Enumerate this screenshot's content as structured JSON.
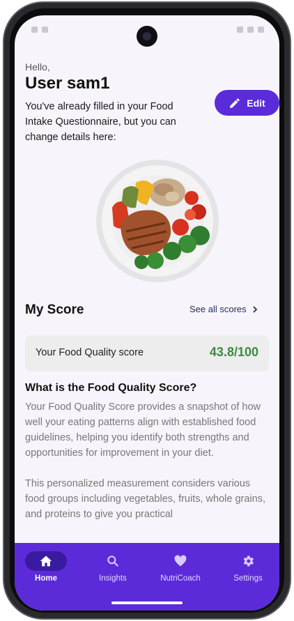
{
  "greeting": "Hello,",
  "username": "User sam1",
  "intro_text": "You've already filled in your Food Intake Questionnaire, but you can change details here:",
  "edit_button": {
    "label": "Edit",
    "icon": "pencil-icon"
  },
  "my_score": {
    "title": "My Score",
    "see_all_label": "See all scores",
    "score_label": "Your Food Quality score",
    "score_value": "43.8/100"
  },
  "fqs": {
    "title": "What is the Food Quality Score?",
    "paragraph1": "Your Food Quality Score provides a snapshot of how well your eating patterns align with established food guidelines, helping you identify both strengths and opportunities for improvement in your diet.",
    "paragraph2": "This personalized measurement considers various food groups including vegetables, fruits, whole grains, and proteins to give you practical"
  },
  "nav": {
    "items": [
      {
        "label": "Home",
        "icon": "home-icon",
        "active": true
      },
      {
        "label": "Insights",
        "icon": "search-icon",
        "active": false
      },
      {
        "label": "NutriCoach",
        "icon": "heart-icon",
        "active": false
      },
      {
        "label": "Settings",
        "icon": "gear-icon",
        "active": false
      }
    ]
  },
  "colors": {
    "accent": "#5b2bd9",
    "score_green": "#3e8a40",
    "background": "#f7f5fb"
  }
}
